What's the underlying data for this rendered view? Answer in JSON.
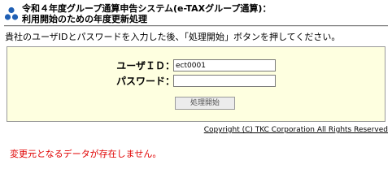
{
  "header": {
    "title_line1": "令和４年度グループ通算申告システム(e-TAXグループ通算)：",
    "title_line2": "利用開始のための年度更新処理",
    "logo_icon": "tkc-logo-icon"
  },
  "instruction": "貴社のユーザIDとパスワードを入力した後、「処理開始」ボタンを押してください。",
  "form": {
    "user_id_label": "ユーザＩＤ：",
    "user_id_value": "ect0001",
    "password_label": "パスワード：",
    "password_value": "",
    "submit_label": "処理開始"
  },
  "footer": {
    "copyright": "Copyright (C) TKC Corporation All Rights Reserved"
  },
  "message": {
    "error": "変更元となるデータが存在しません。"
  },
  "colors": {
    "panel_bg": "#feffe0",
    "error_text": "#e00000",
    "logo_blue": "#1f5fb4"
  }
}
